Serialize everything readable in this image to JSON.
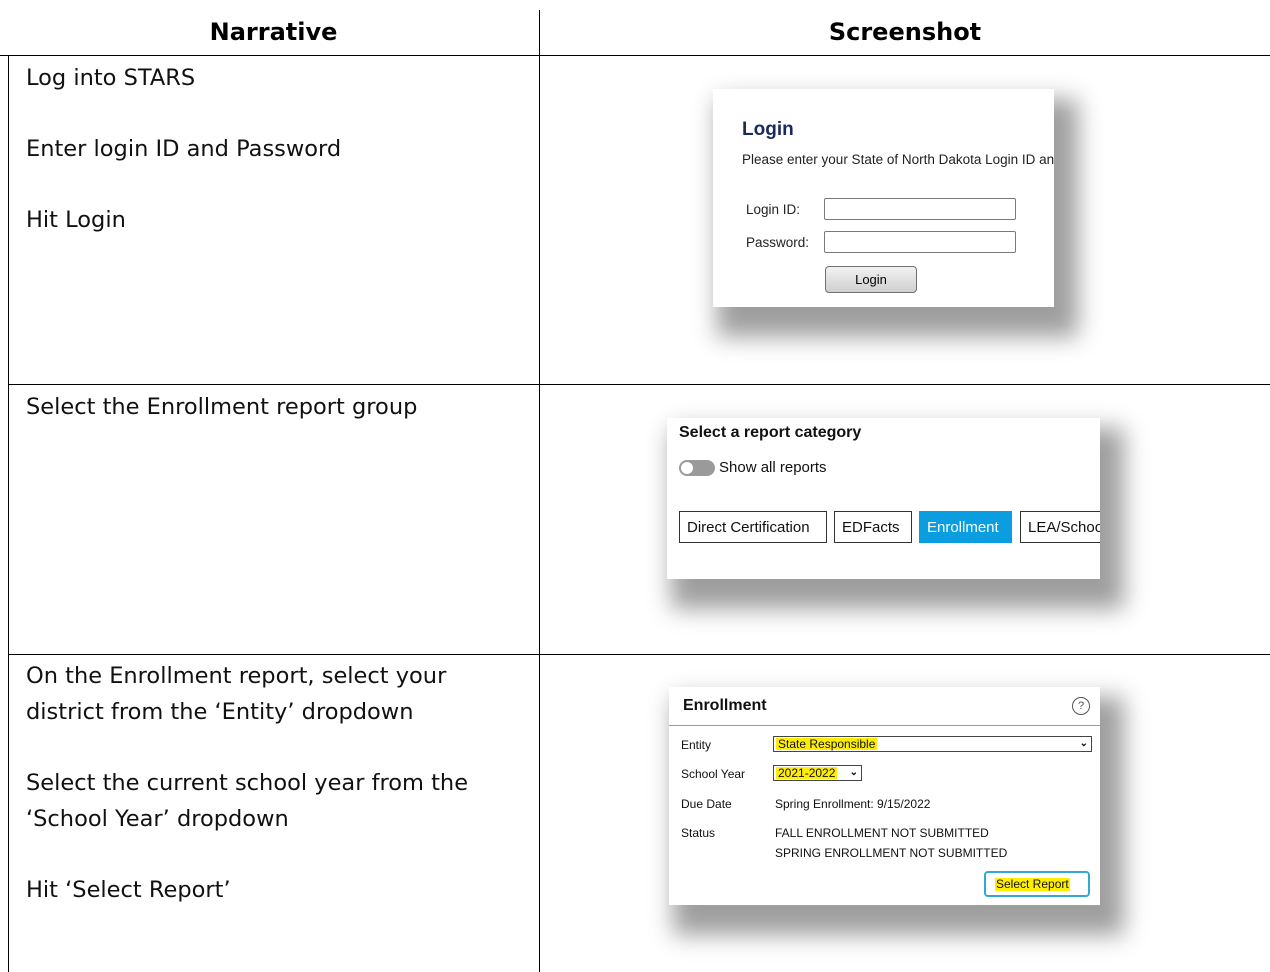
{
  "table": {
    "headers": {
      "narrative": "Narrative",
      "screenshot": "Screenshot"
    },
    "rows": [
      {
        "narrative": [
          "Log into STARS",
          "Enter login ID and Password",
          "Hit Login"
        ]
      },
      {
        "narrative": [
          "Select the Enrollment report group"
        ]
      },
      {
        "narrative": [
          "On the Enrollment report, select your",
          "district from the ‘Entity’ dropdown",
          "Select the current school year from the",
          "‘School Year’ dropdown",
          "Hit ‘Select Report’"
        ]
      }
    ]
  },
  "login_panel": {
    "title": "Login",
    "instructions": "Please enter your State of North Dakota Login ID and Password.",
    "login_id_label": "Login ID:",
    "password_label": "Password:",
    "login_id_value": "",
    "password_value": "",
    "login_button": "Login"
  },
  "category_panel": {
    "title": "Select a report category",
    "toggle_label": "Show all reports",
    "buttons": [
      "Direct Certification",
      "EDFacts",
      "Enrollment",
      "LEA/School"
    ],
    "active_button": "Enrollment",
    "active_color": "#0a9ee0"
  },
  "enrollment_panel": {
    "title": "Enrollment",
    "help_icon": "question-circle-icon",
    "entity_label": "Entity",
    "entity_value": "State Responsible",
    "school_year_label": "School Year",
    "school_year_value": "2021-2022",
    "due_date_label": "Due Date",
    "due_date_value": "Spring Enrollment: 9/15/2022",
    "status_label": "Status",
    "status_lines": [
      "FALL ENROLLMENT NOT SUBMITTED",
      "SPRING ENROLLMENT NOT SUBMITTED"
    ],
    "select_button": "Select Report",
    "highlight_color": "#ffee00"
  }
}
